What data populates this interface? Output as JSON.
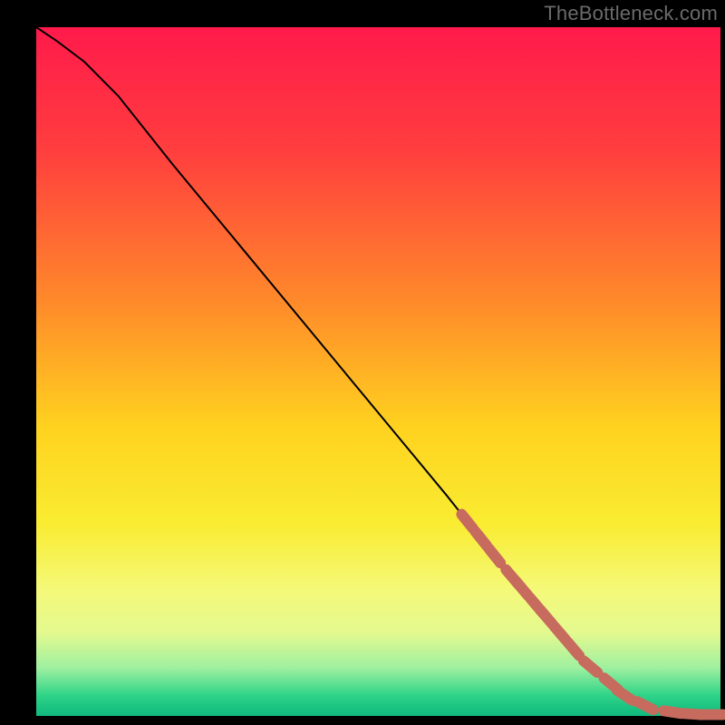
{
  "watermark": "TheBottleneck.com",
  "colors": {
    "black": "#000000",
    "curve": "#000000",
    "marker_fill": "#c76b5e",
    "marker_stroke": "#a8584c"
  },
  "chart_data": {
    "type": "line",
    "title": "",
    "xlabel": "",
    "ylabel": "",
    "grid": false,
    "xlim": [
      0,
      100
    ],
    "ylim": [
      0,
      100
    ],
    "gradient_stops": [
      {
        "pct": 0,
        "color": "#ff1a4b"
      },
      {
        "pct": 18,
        "color": "#ff3e3e"
      },
      {
        "pct": 40,
        "color": "#ff8a2a"
      },
      {
        "pct": 58,
        "color": "#ffd21f"
      },
      {
        "pct": 72,
        "color": "#f9ec31"
      },
      {
        "pct": 82,
        "color": "#f4f97a"
      },
      {
        "pct": 88,
        "color": "#e3f98f"
      },
      {
        "pct": 93,
        "color": "#9ff0a0"
      },
      {
        "pct": 97,
        "color": "#2fd488"
      },
      {
        "pct": 100,
        "color": "#0fb87e"
      }
    ],
    "series": [
      {
        "name": "bottleneck-curve",
        "x": [
          0,
          3,
          7,
          12,
          20,
          30,
          40,
          50,
          60,
          68,
          74,
          80,
          86,
          90,
          94,
          97,
          100
        ],
        "y": [
          100,
          98,
          95,
          90,
          80,
          68,
          56,
          44,
          32,
          22,
          15,
          8,
          3,
          1,
          0.4,
          0.2,
          0.2
        ]
      }
    ],
    "markers": {
      "name": "highlighted-range",
      "points": [
        {
          "x": 63,
          "y": 29
        },
        {
          "x": 65,
          "y": 27
        },
        {
          "x": 67,
          "y": 24.5
        },
        {
          "x": 69.5,
          "y": 21.5
        },
        {
          "x": 71,
          "y": 19.5
        },
        {
          "x": 73,
          "y": 17
        },
        {
          "x": 74.5,
          "y": 15
        },
        {
          "x": 76.5,
          "y": 12.5
        },
        {
          "x": 78.5,
          "y": 10
        },
        {
          "x": 81,
          "y": 7
        },
        {
          "x": 84,
          "y": 4.5
        },
        {
          "x": 86,
          "y": 2.5
        },
        {
          "x": 89,
          "y": 1
        },
        {
          "x": 93,
          "y": 0.4
        },
        {
          "x": 96,
          "y": 0.3
        },
        {
          "x": 99,
          "y": 0.2
        }
      ]
    }
  }
}
